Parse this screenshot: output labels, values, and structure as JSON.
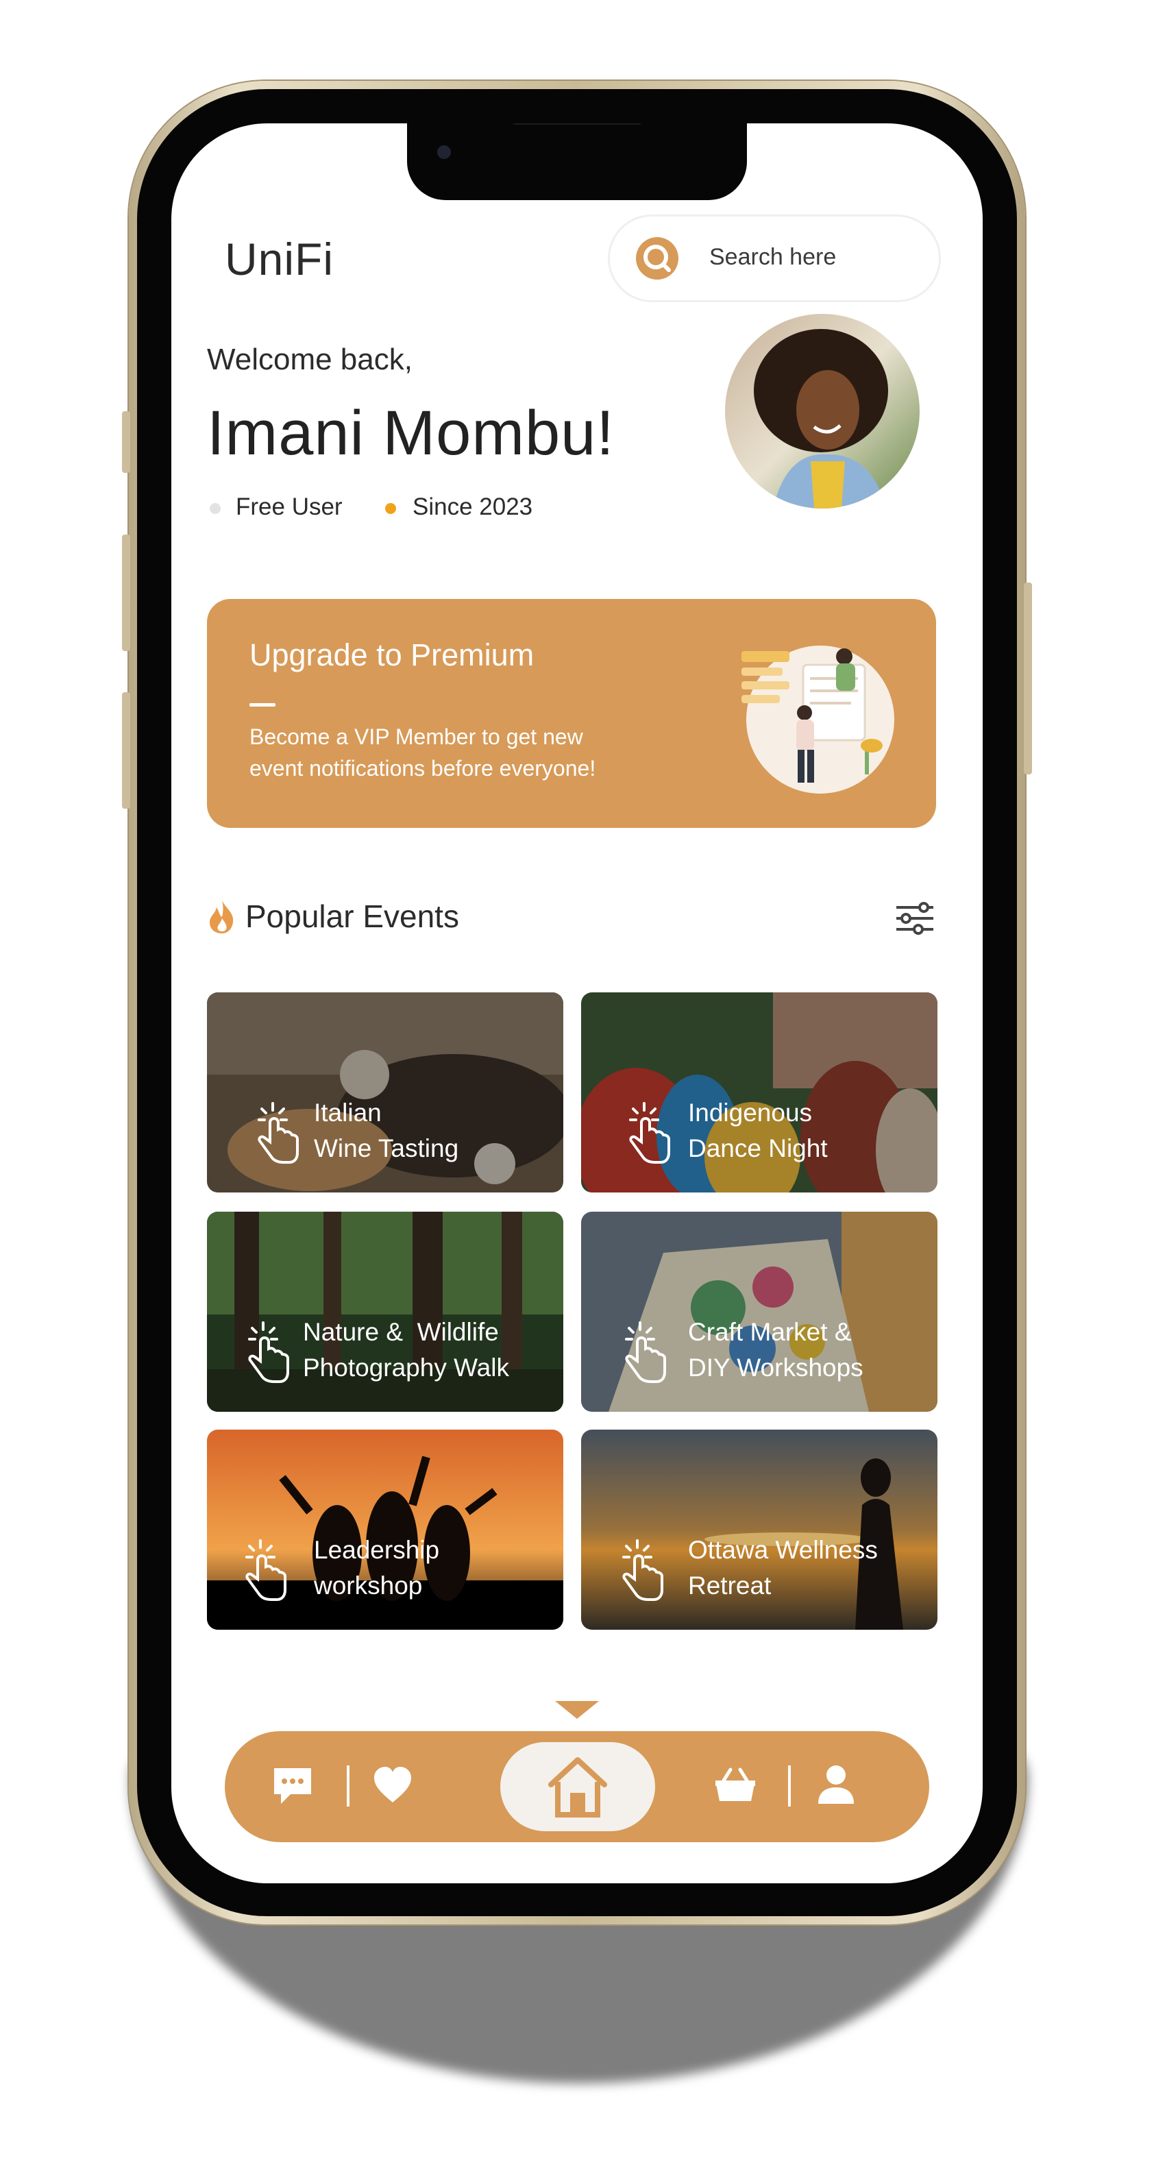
{
  "app": {
    "title": "UniFi"
  },
  "search": {
    "placeholder": "Search here"
  },
  "profile": {
    "greeting": "Welcome back,",
    "name": "Imani Mombu!",
    "tags": [
      {
        "label": "Free User",
        "color": "#e2e2e2"
      },
      {
        "label": "Since 2023",
        "color": "#f0a21b"
      }
    ]
  },
  "banner": {
    "title": "Upgrade to Premium",
    "text": "Become a VIP Member to get new event notifications before everyone!"
  },
  "popular": {
    "title": "Popular Events",
    "events": [
      {
        "line1": "Italian",
        "line2": "Wine Tasting"
      },
      {
        "line1": "Indigenous",
        "line2": "Dance Night"
      },
      {
        "line1": "Nature &  Wildlife",
        "line2": "Photography Walk"
      },
      {
        "line1": "Craft Market &",
        "line2": "DIY Workshops"
      },
      {
        "line1": "Leadership",
        "line2": "workshop"
      },
      {
        "line1": "Ottawa Wellness",
        "line2": "Retreat"
      }
    ]
  },
  "nav": {
    "items": [
      "chat-icon",
      "heart-icon",
      "home-icon",
      "basket-icon",
      "user-icon"
    ],
    "active": "home-icon"
  },
  "colors": {
    "accent": "#d79a58",
    "frame": "#c9bb98"
  }
}
